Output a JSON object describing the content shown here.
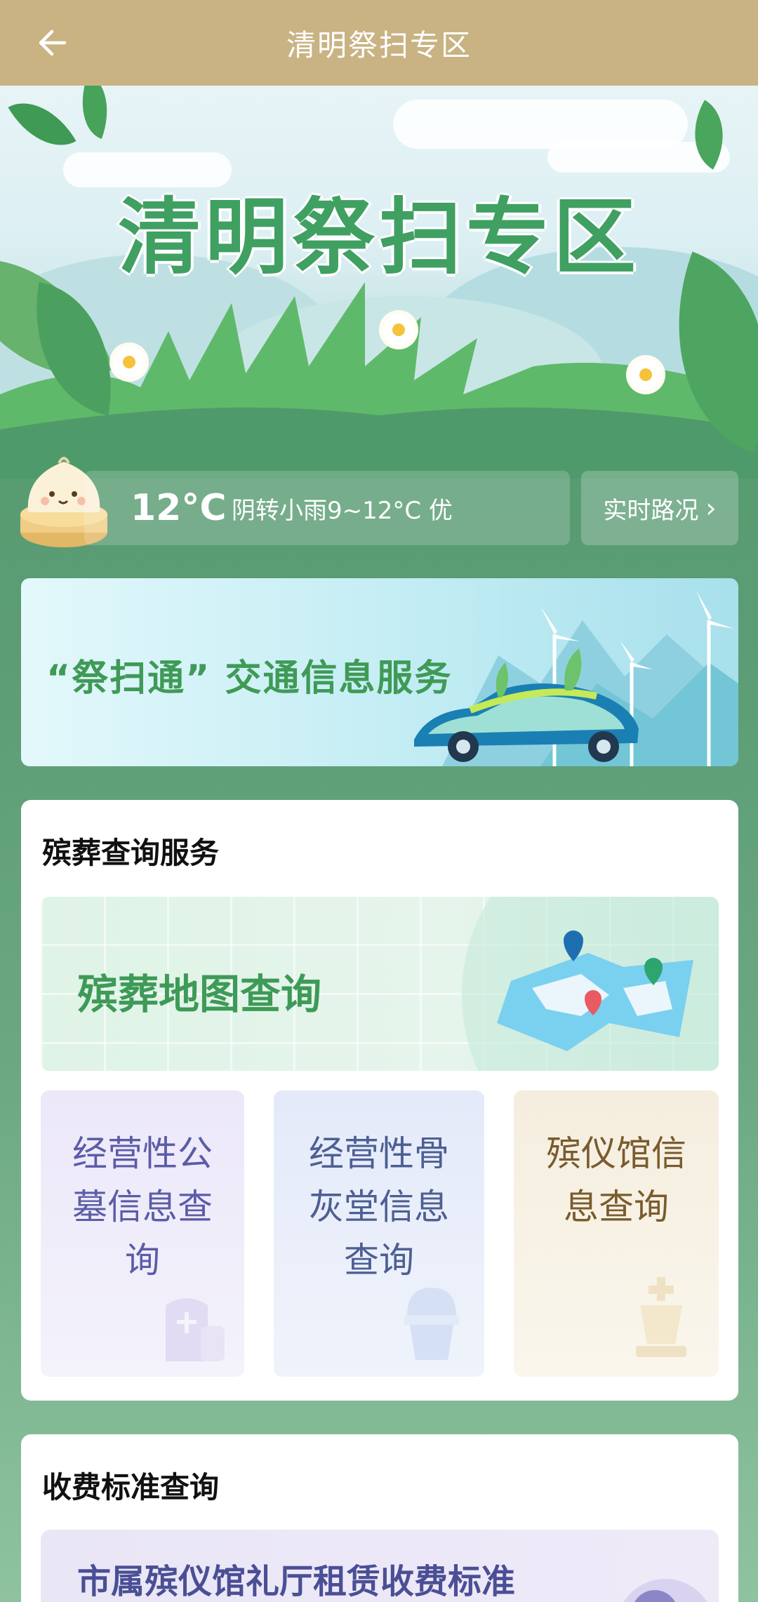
{
  "header": {
    "title": "清明祭扫专区"
  },
  "hero": {
    "title": "清明祭扫专区"
  },
  "weather": {
    "temperature": "12°C",
    "description": "阴转小雨9~12°C 优",
    "traffic_label": "实时路况",
    "traffic_arrow": "›"
  },
  "banner": {
    "text": "“祭扫通” 交通信息服务"
  },
  "funeral_section": {
    "title": "殡葬查询服务",
    "map_query": "殡葬地图查询",
    "tiles": [
      {
        "label": "经营性公墓信息查询"
      },
      {
        "label": "经营性骨灰堂信息查询"
      },
      {
        "label": "殡仪馆信息查询"
      }
    ]
  },
  "fee_section": {
    "title": "收费标准查询",
    "item": "市属殡仪馆礼厅租赁收费标准",
    "icon_glyph": "¥"
  },
  "colors": {
    "topbar": "#c9b383",
    "accent_green": "#3fa062",
    "tile1_text": "#5b5ca8",
    "tile2_text": "#4d5f93",
    "tile3_text": "#7a5b2d"
  }
}
